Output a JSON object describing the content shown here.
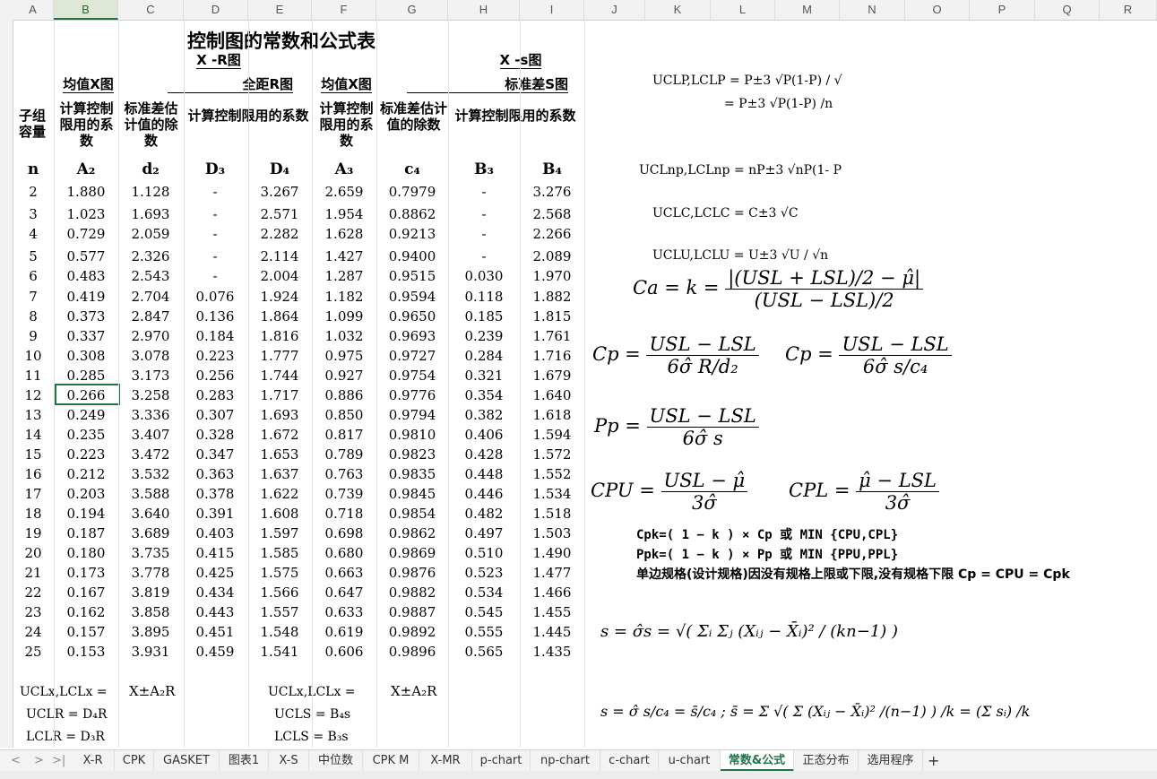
{
  "columns": [
    "A",
    "B",
    "C",
    "D",
    "E",
    "F",
    "G",
    "H",
    "I",
    "J",
    "K",
    "L",
    "M",
    "N",
    "O",
    "P",
    "Q",
    "R"
  ],
  "rows": [
    "",
    "",
    "",
    "",
    "",
    "",
    "",
    "",
    "",
    "",
    "",
    "",
    "",
    "",
    "",
    "",
    "",
    "",
    "",
    "",
    "",
    "",
    "",
    "",
    "",
    "",
    "",
    "",
    "",
    "",
    "",
    "",
    "",
    "",
    ""
  ],
  "title": "控制图的常数和公式表",
  "group_xr": "X -R图",
  "group_xs": "X -s图",
  "mean_x_chart_1": "均值X图",
  "range_chart": "全距R图",
  "mean_x_chart_2": "均值X图",
  "std_chart": "标准差S图",
  "col_headers": {
    "subgroup": "子组容量",
    "coef_mean_1": "计算控制限用的系数",
    "std_est_1": "标准差估计值的除数",
    "coef_range": "计算控制限用的系数",
    "coef_mean_2": "计算控制限用的系数",
    "std_est_2": "标准差估计值的除数",
    "coef_std": "计算控制限用的系数"
  },
  "symbols": [
    "n",
    "A₂",
    "d₂",
    "D₃",
    "D₄",
    "A₃",
    "c₄",
    "B₃",
    "B₄"
  ],
  "table": [
    [
      "2",
      "1.880",
      "1.128",
      "-",
      "3.267",
      "2.659",
      "0.7979",
      "-",
      "3.276"
    ],
    [
      "3",
      "1.023",
      "1.693",
      "-",
      "2.571",
      "1.954",
      "0.8862",
      "-",
      "2.568"
    ],
    [
      "4",
      "0.729",
      "2.059",
      "-",
      "2.282",
      "1.628",
      "0.9213",
      "-",
      "2.266"
    ],
    [
      "5",
      "0.577",
      "2.326",
      "-",
      "2.114",
      "1.427",
      "0.9400",
      "-",
      "2.089"
    ],
    [
      "6",
      "0.483",
      "2.543",
      "-",
      "2.004",
      "1.287",
      "0.9515",
      "0.030",
      "1.970"
    ],
    [
      "7",
      "0.419",
      "2.704",
      "0.076",
      "1.924",
      "1.182",
      "0.9594",
      "0.118",
      "1.882"
    ],
    [
      "8",
      "0.373",
      "2.847",
      "0.136",
      "1.864",
      "1.099",
      "0.9650",
      "0.185",
      "1.815"
    ],
    [
      "9",
      "0.337",
      "2.970",
      "0.184",
      "1.816",
      "1.032",
      "0.9693",
      "0.239",
      "1.761"
    ],
    [
      "10",
      "0.308",
      "3.078",
      "0.223",
      "1.777",
      "0.975",
      "0.9727",
      "0.284",
      "1.716"
    ],
    [
      "11",
      "0.285",
      "3.173",
      "0.256",
      "1.744",
      "0.927",
      "0.9754",
      "0.321",
      "1.679"
    ],
    [
      "12",
      "0.266",
      "3.258",
      "0.283",
      "1.717",
      "0.886",
      "0.9776",
      "0.354",
      "1.640"
    ],
    [
      "13",
      "0.249",
      "3.336",
      "0.307",
      "1.693",
      "0.850",
      "0.9794",
      "0.382",
      "1.618"
    ],
    [
      "14",
      "0.235",
      "3.407",
      "0.328",
      "1.672",
      "0.817",
      "0.9810",
      "0.406",
      "1.594"
    ],
    [
      "15",
      "0.223",
      "3.472",
      "0.347",
      "1.653",
      "0.789",
      "0.9823",
      "0.428",
      "1.572"
    ],
    [
      "16",
      "0.212",
      "3.532",
      "0.363",
      "1.637",
      "0.763",
      "0.9835",
      "0.448",
      "1.552"
    ],
    [
      "17",
      "0.203",
      "3.588",
      "0.378",
      "1.622",
      "0.739",
      "0.9845",
      "0.446",
      "1.534"
    ],
    [
      "18",
      "0.194",
      "3.640",
      "0.391",
      "1.608",
      "0.718",
      "0.9854",
      "0.482",
      "1.518"
    ],
    [
      "19",
      "0.187",
      "3.689",
      "0.403",
      "1.597",
      "0.698",
      "0.9862",
      "0.497",
      "1.503"
    ],
    [
      "20",
      "0.180",
      "3.735",
      "0.415",
      "1.585",
      "0.680",
      "0.9869",
      "0.510",
      "1.490"
    ],
    [
      "21",
      "0.173",
      "3.778",
      "0.425",
      "1.575",
      "0.663",
      "0.9876",
      "0.523",
      "1.477"
    ],
    [
      "22",
      "0.167",
      "3.819",
      "0.434",
      "1.566",
      "0.647",
      "0.9882",
      "0.534",
      "1.466"
    ],
    [
      "23",
      "0.162",
      "3.858",
      "0.443",
      "1.557",
      "0.633",
      "0.9887",
      "0.545",
      "1.455"
    ],
    [
      "24",
      "0.157",
      "3.895",
      "0.451",
      "1.548",
      "0.619",
      "0.9892",
      "0.555",
      "1.445"
    ],
    [
      "25",
      "0.153",
      "3.931",
      "0.459",
      "1.541",
      "0.606",
      "0.9896",
      "0.565",
      "1.435"
    ]
  ],
  "bottom": {
    "ucl_x_r": "UCLx,LCLx =",
    "ucl_x_r_val": "X±A₂R",
    "ucl_r": "UCLR = D₄R",
    "lcl_r": "LCLR = D₃R",
    "ucl_x_s": "UCLx,LCLx =",
    "ucl_x_s_val": "X±A₂R",
    "ucl_s": "UCLS = B₄s",
    "lcl_s": "LCLS = B₃s"
  },
  "formulas": {
    "p1": "UCLP,LCLP = P±3 √P(1-P) / √",
    "p2": "= P±3 √P(1-P) /n",
    "np": "UCLnp,LCLnp = nP±3 √nP(1- P",
    "c": "UCLC,LCLC = C±3 √C",
    "u": "UCLU,LCLU = U±3 √U / √n",
    "ca_left": "Ca = k =",
    "ca_num": "|(USL + LSL)/2 − μ̂|",
    "ca_den": "(USL − LSL)/2",
    "cp1_left": "Cp =",
    "cp1_num": "USL − LSL",
    "cp1_den": "6σ̂ R/d₂",
    "cp2_left": "Cp =",
    "cp2_num": "USL − LSL",
    "cp2_den": "6σ̂ s/c₄",
    "pp_left": "Pp =",
    "pp_num": "USL − LSL",
    "pp_den": "6σ̂ s",
    "cpu_left": "CPU =",
    "cpu_num": "USL − μ̂",
    "cpu_den": "3σ̂",
    "cpl_left": "CPL =",
    "cpl_num": "μ̂ − LSL",
    "cpl_den": "3σ̂",
    "cpk": "Cpk=( 1 − k ) × Cp 或 MIN {CPU,CPL}",
    "ppk": "Ppk=( 1 − k ) × Pp 或 MIN {PPU,PPL}",
    "single": "单边规格(设计规格)因没有规格上限或下限,没有规格下限 Cp = CPU = Cpk",
    "s1": "s = σ̂s = √( Σᵢ Σⱼ (Xᵢⱼ − X̄ᵢ)² / (kn−1) )",
    "s2": "s = σ̂ s/c₄ = s̄/c₄ ; s̄ = Σ √( Σ (Xᵢⱼ − X̄ᵢ)² /(n−1) ) /k = (Σ sᵢ) /k"
  },
  "tabs": [
    "X-R",
    "CPK",
    "GASKET",
    "图表1",
    "X-S",
    "中位数",
    "CPK M",
    "X-MR",
    "p-chart",
    "np-chart",
    "c-chart",
    "u-chart",
    "常数&公式",
    "正态分布",
    "选用程序"
  ],
  "active_tab": "常数&公式",
  "add_tab": "+",
  "nav": [
    "<",
    ">",
    ">|"
  ]
}
